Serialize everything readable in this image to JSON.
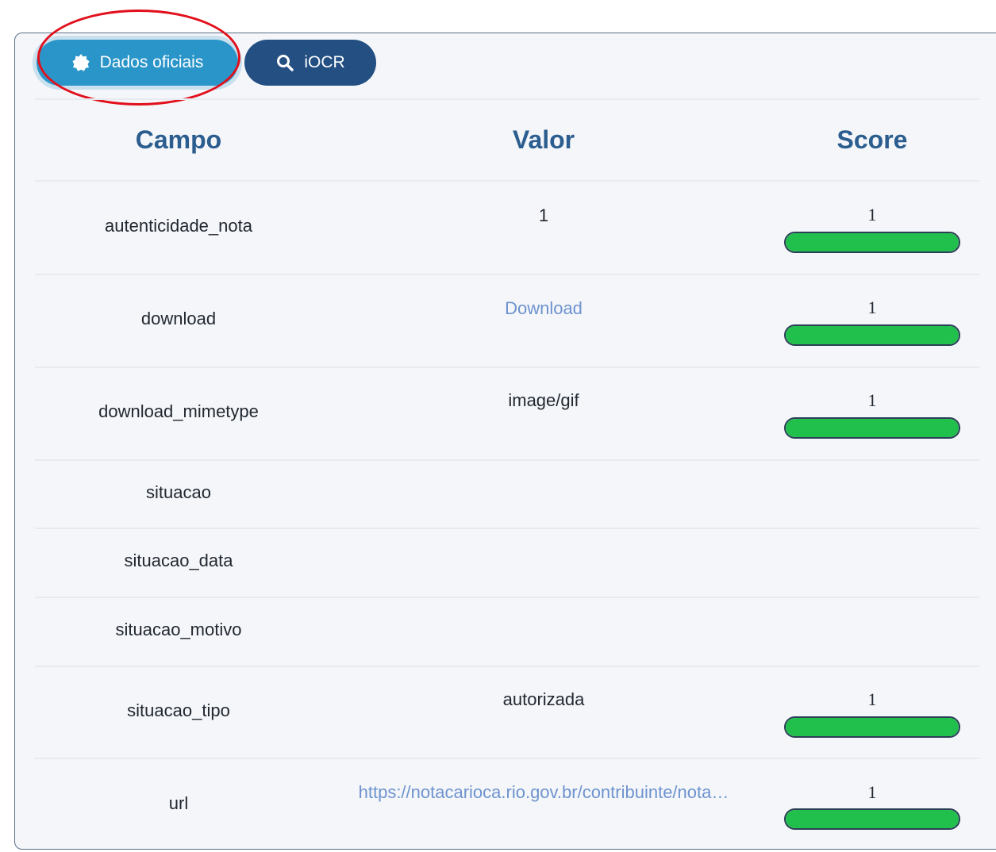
{
  "tabs": {
    "dados_label": "Dados oficiais",
    "iocr_label": "iOCR"
  },
  "table": {
    "headers": {
      "campo": "Campo",
      "valor": "Valor",
      "score": "Score"
    },
    "rows": [
      {
        "campo": "autenticidade_nota",
        "valor": "1",
        "score": "1",
        "score_fraction": 1
      },
      {
        "campo": "download",
        "valor": "Download",
        "score": "1",
        "score_fraction": 1,
        "valor_is_link": true
      },
      {
        "campo": "download_mimetype",
        "valor": "image/gif",
        "score": "1",
        "score_fraction": 1
      },
      {
        "campo": "situacao",
        "valor": "",
        "score": ""
      },
      {
        "campo": "situacao_data",
        "valor": "",
        "score": ""
      },
      {
        "campo": "situacao_motivo",
        "valor": "",
        "score": ""
      },
      {
        "campo": "situacao_tipo",
        "valor": "autorizada",
        "score": "1",
        "score_fraction": 1
      },
      {
        "campo": "url",
        "valor": "https://notacarioca.rio.gov.br/contribuinte/nota…",
        "score": "1",
        "score_fraction": 1,
        "valor_is_link": true
      }
    ]
  },
  "colors": {
    "tab_active": "#2a95c9",
    "tab_inactive": "#234f82",
    "header_text": "#2b5d8f",
    "link": "#6e93cf",
    "score_bar": "#21c04c",
    "annotation": "#e2101c"
  },
  "icons": {
    "dados_icon": "badge-check-icon",
    "iocr_icon": "search-icon"
  }
}
